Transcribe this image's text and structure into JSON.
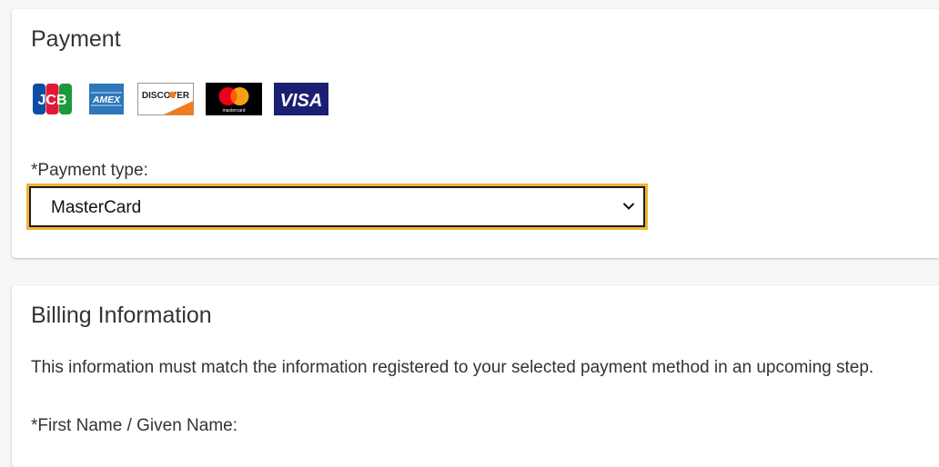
{
  "payment": {
    "title": "Payment",
    "card_logos": [
      {
        "name": "JCB",
        "text": "JCB"
      },
      {
        "name": "American Express",
        "text": "AMEX"
      },
      {
        "name": "Discover",
        "text": "DISCOVER"
      },
      {
        "name": "Mastercard",
        "text": "mastercard"
      },
      {
        "name": "Visa",
        "text": "VISA"
      }
    ],
    "type_label": "*Payment type:",
    "type_selected": "MasterCard"
  },
  "billing": {
    "title": "Billing Information",
    "description": "This information must match the information registered to your selected payment method in an upcoming step.",
    "first_name_label": "*First Name / Given Name:"
  },
  "colors": {
    "focus_outline": "#f2b32f",
    "text": "#333333",
    "page_background": "#f6f6f6"
  }
}
